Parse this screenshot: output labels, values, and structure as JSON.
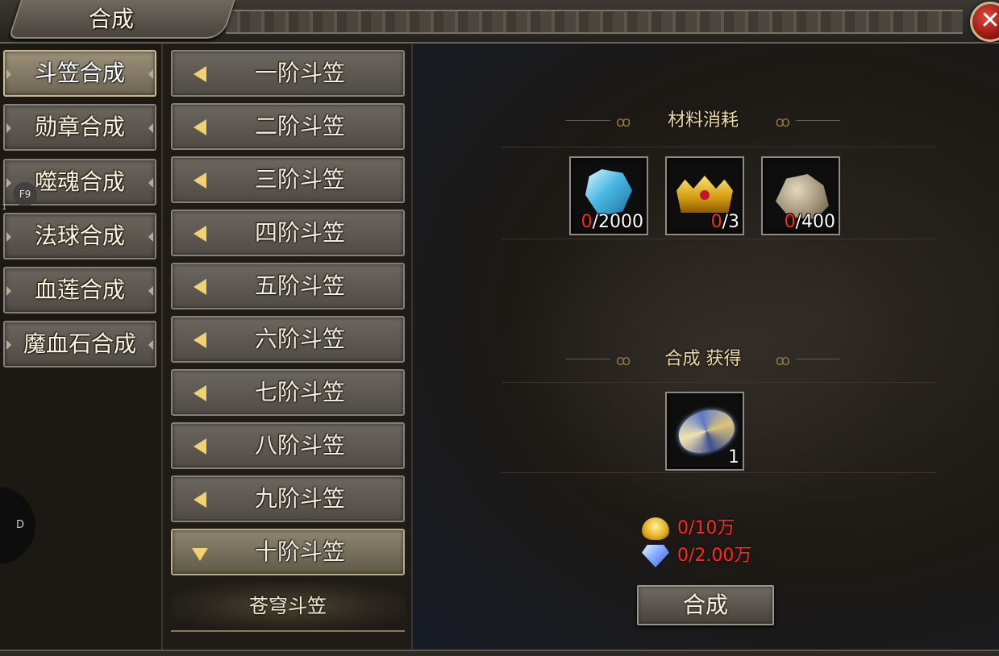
{
  "window": {
    "title": "合成",
    "close_label": "✕"
  },
  "overlay": {
    "f9_badge": "F9",
    "side_label": "D",
    "tiny_mark": "1"
  },
  "categories": [
    {
      "label": "斗笠合成",
      "active": true
    },
    {
      "label": "勋章合成",
      "active": false
    },
    {
      "label": "噬魂合成",
      "active": false
    },
    {
      "label": "法球合成",
      "active": false
    },
    {
      "label": "血莲合成",
      "active": false
    },
    {
      "label": "魔血石合成",
      "active": false
    }
  ],
  "tiers": [
    {
      "label": "一阶斗笠",
      "expanded": false
    },
    {
      "label": "二阶斗笠",
      "expanded": false
    },
    {
      "label": "三阶斗笠",
      "expanded": false
    },
    {
      "label": "四阶斗笠",
      "expanded": false
    },
    {
      "label": "五阶斗笠",
      "expanded": false
    },
    {
      "label": "六阶斗笠",
      "expanded": false
    },
    {
      "label": "七阶斗笠",
      "expanded": false
    },
    {
      "label": "八阶斗笠",
      "expanded": false
    },
    {
      "label": "九阶斗笠",
      "expanded": false
    },
    {
      "label": "十阶斗笠",
      "expanded": true
    }
  ],
  "selected_item": {
    "label": "苍穹斗笠"
  },
  "materials": {
    "title": "材料消耗",
    "items": [
      {
        "icon": "blue-crystal-icon",
        "have": "0",
        "need": "/2000"
      },
      {
        "icon": "gold-crown-icon",
        "have": "0",
        "need": "/3"
      },
      {
        "icon": "ore-rock-icon",
        "have": "0",
        "need": "/400"
      }
    ]
  },
  "result": {
    "title": "合成 获得",
    "item": {
      "icon": "hat-icon",
      "count": "1"
    }
  },
  "costs": [
    {
      "icon": "gold-ingot-icon",
      "text": "0/10万"
    },
    {
      "icon": "diamond-icon",
      "text": "0/2.00万"
    }
  ],
  "compose_button": {
    "label": "合成"
  },
  "colors": {
    "shortfall": "#ff2a1f",
    "accent_gold": "#f2d173"
  }
}
